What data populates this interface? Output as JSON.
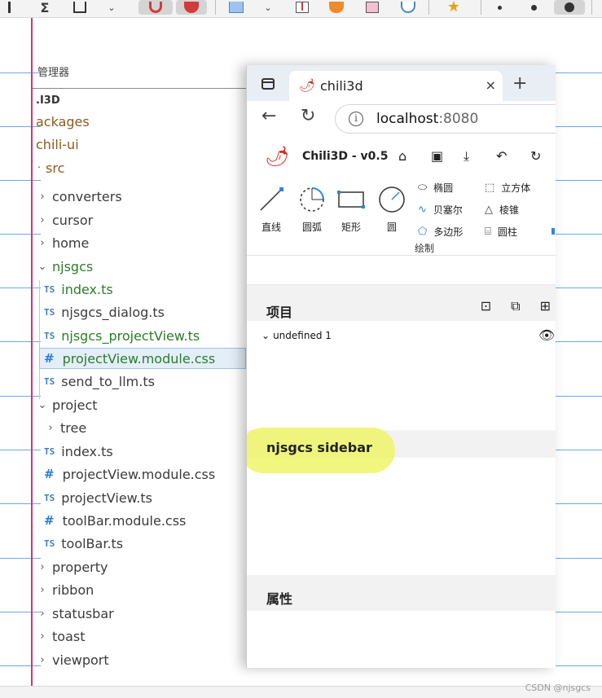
{
  "explorer": {
    "title": "管理器",
    "items": [
      {
        "label": ".I3D",
        "kind": "root"
      },
      {
        "label": "ackages",
        "kind": "folder-brown"
      },
      {
        "label": "chili-ui",
        "kind": "folder-brown"
      },
      {
        "label": "src",
        "kind": "folder-brown"
      },
      {
        "label": "converters",
        "kind": "folder"
      },
      {
        "label": "cursor",
        "kind": "folder"
      },
      {
        "label": "home",
        "kind": "folder"
      },
      {
        "label": "njsgcs",
        "kind": "folder-open-green"
      },
      {
        "label": "index.ts",
        "kind": "ts-green",
        "badge": "TS"
      },
      {
        "label": "njsgcs_dialog.ts",
        "kind": "ts",
        "badge": "TS"
      },
      {
        "label": "njsgcs_projectView.ts",
        "kind": "ts-green",
        "badge": "TS"
      },
      {
        "label": "projectView.module.css",
        "kind": "css-green-selected",
        "badge": "#"
      },
      {
        "label": "send_to_llm.ts",
        "kind": "ts",
        "badge": "TS"
      },
      {
        "label": "project",
        "kind": "folder-open"
      },
      {
        "label": "tree",
        "kind": "folder"
      },
      {
        "label": "index.ts",
        "kind": "ts",
        "badge": "TS"
      },
      {
        "label": "projectView.module.css",
        "kind": "css",
        "badge": "#"
      },
      {
        "label": "projectView.ts",
        "kind": "ts",
        "badge": "TS"
      },
      {
        "label": "toolBar.module.css",
        "kind": "css",
        "badge": "#"
      },
      {
        "label": "toolBar.ts",
        "kind": "ts",
        "badge": "TS"
      },
      {
        "label": "property",
        "kind": "folder"
      },
      {
        "label": "ribbon",
        "kind": "folder"
      },
      {
        "label": "statusbar",
        "kind": "folder"
      },
      {
        "label": "toast",
        "kind": "folder"
      },
      {
        "label": "viewport",
        "kind": "folder"
      }
    ]
  },
  "browser": {
    "tab_title": "chili3d",
    "tab_close": "×",
    "new_tab": "+",
    "url_host": "localhost",
    "url_port": ":8080",
    "info_glyph": "i"
  },
  "app": {
    "title": "Chili3D - v0.5",
    "ribbon": {
      "buttons": [
        {
          "label": "直线",
          "icon": "line-icon"
        },
        {
          "label": "圆弧",
          "icon": "arc-icon"
        },
        {
          "label": "矩形",
          "icon": "rectangle-icon"
        },
        {
          "label": "圆",
          "icon": "circle-icon"
        }
      ],
      "small_col1": [
        "椭圆",
        "贝塞尔",
        "多边形"
      ],
      "small_col2": [
        "立方体",
        "棱锥",
        "圆柱"
      ],
      "group_label": "绘制"
    },
    "project_title": "项目",
    "tree_item": "undefined 1",
    "sidebar_title": "njsgcs sidebar",
    "property_title": "属性"
  },
  "watermark": "CSDN @njsgcs",
  "colors": {
    "accent_guide": "#6fa7e6",
    "magenta_line": "#d6307b",
    "highlight": "#eef567"
  }
}
